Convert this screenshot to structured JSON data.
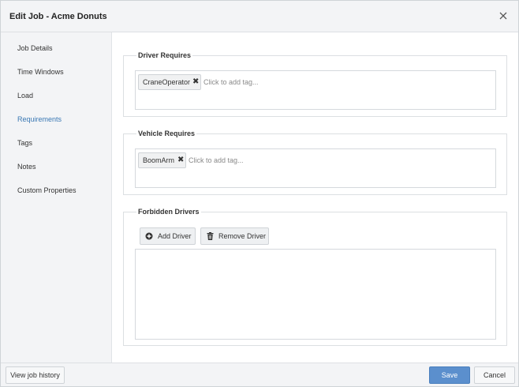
{
  "dialog": {
    "title": "Edit Job - Acme Donuts"
  },
  "sidebar": {
    "items": [
      {
        "label": "Job Details"
      },
      {
        "label": "Time Windows"
      },
      {
        "label": "Load"
      },
      {
        "label": "Requirements",
        "active": true
      },
      {
        "label": "Tags"
      },
      {
        "label": "Notes"
      },
      {
        "label": "Custom Properties"
      }
    ]
  },
  "driver_requires": {
    "legend": "Driver Requires",
    "tags": [
      "CraneOperator"
    ],
    "placeholder": "Click to add tag..."
  },
  "vehicle_requires": {
    "legend": "Vehicle Requires",
    "tags": [
      "BoomArm"
    ],
    "placeholder": "Click to add tag..."
  },
  "forbidden_drivers": {
    "legend": "Forbidden Drivers",
    "add_label": "Add Driver",
    "remove_label": "Remove Driver",
    "drivers": []
  },
  "footer": {
    "history_label": "View job history",
    "save_label": "Save",
    "cancel_label": "Cancel"
  },
  "colors": {
    "accent": "#3a78b4",
    "save_button": "#5b8fcd",
    "panel_background": "#f3f4f6"
  }
}
